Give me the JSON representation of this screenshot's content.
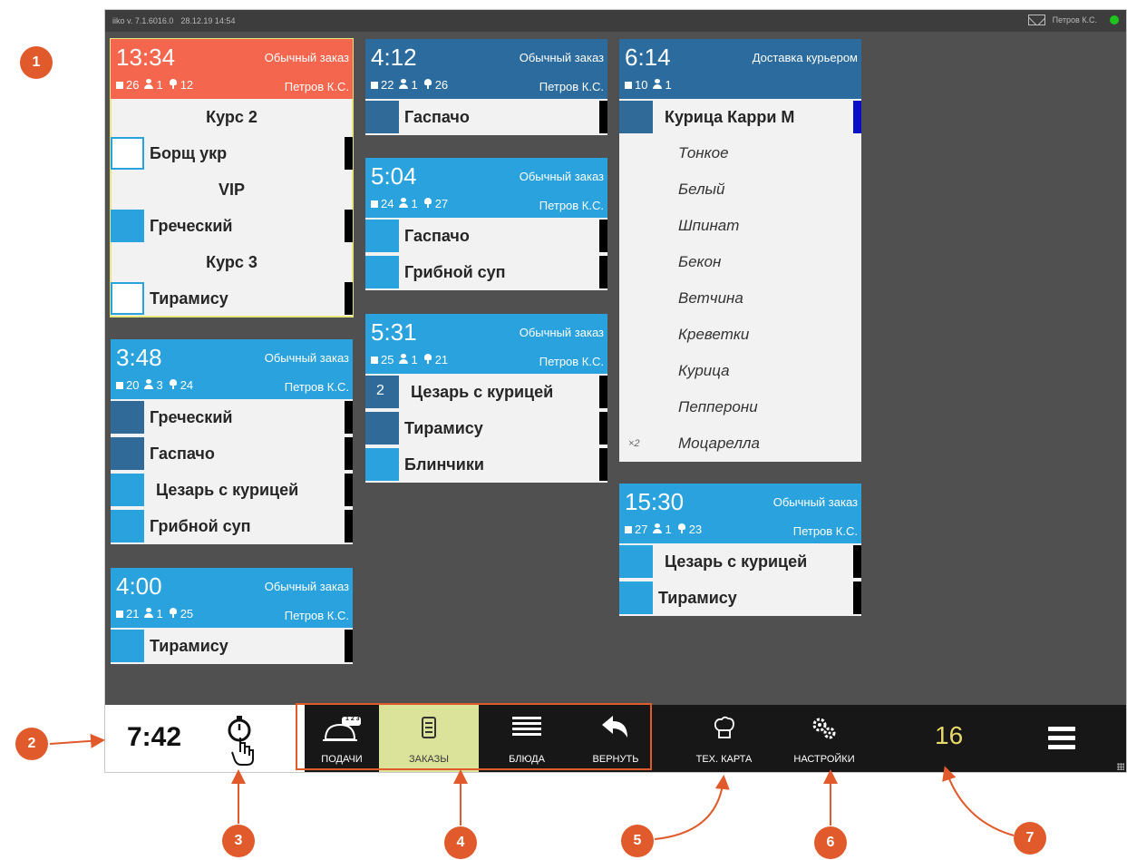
{
  "titlebar": {
    "version": "iiko  v. 7.1.6016.0",
    "datetime": "28.12.19  14:54",
    "user": "Петров К.С."
  },
  "colors": {
    "red_header": "#f4664e",
    "blue_header": "#29a2de",
    "dark_header": "#2b6b9d",
    "active_tab": "#dbe39a",
    "count": "#e6d96a",
    "callout": "#e05a2b"
  },
  "orders": [
    {
      "time": "13:34",
      "type": "Обычный заказ",
      "table": "26",
      "guests": "1",
      "order_no": "12",
      "waiter": "Петров К.С.",
      "items": [
        {
          "kind": "course",
          "name": "Курс 2"
        },
        {
          "kind": "dish",
          "name": "Борщ укр"
        },
        {
          "kind": "course",
          "name": "VIP"
        },
        {
          "kind": "dish",
          "name": "Греческий"
        },
        {
          "kind": "course",
          "name": "Курс 3"
        },
        {
          "kind": "dish",
          "name": "Тирамису"
        }
      ]
    },
    {
      "time": "3:48",
      "type": "Обычный заказ",
      "table": "20",
      "guests": "3",
      "order_no": "24",
      "waiter": "Петров К.С.",
      "items": [
        {
          "name": "Греческий"
        },
        {
          "name": "Гаспачо"
        },
        {
          "name": "Цезарь с курицей"
        },
        {
          "name": "Грибной суп"
        }
      ]
    },
    {
      "time": "4:00",
      "type": "Обычный заказ",
      "table": "21",
      "guests": "1",
      "order_no": "25",
      "waiter": "Петров К.С.",
      "items": [
        {
          "name": "Тирамису"
        }
      ]
    },
    {
      "time": "4:12",
      "type": "Обычный заказ",
      "table": "22",
      "guests": "1",
      "order_no": "26",
      "waiter": "Петров К.С.",
      "items": [
        {
          "name": "Гаспачо"
        }
      ]
    },
    {
      "time": "5:04",
      "type": "Обычный заказ",
      "table": "24",
      "guests": "1",
      "order_no": "27",
      "waiter": "Петров К.С.",
      "items": [
        {
          "name": "Гаспачо"
        },
        {
          "name": "Грибной суп"
        }
      ]
    },
    {
      "time": "5:31",
      "type": "Обычный заказ",
      "table": "25",
      "guests": "1",
      "order_no": "21",
      "waiter": "Петров К.С.",
      "items": [
        {
          "name": "Цезарь с курицей",
          "qty": "2"
        },
        {
          "name": "Тирамису"
        },
        {
          "name": "Блинчики"
        }
      ]
    },
    {
      "time": "6:14",
      "type": "Доставка курьером",
      "table": "10",
      "guests": "1",
      "items": [
        {
          "name": "Курица Карри М"
        }
      ],
      "modifiers": [
        {
          "name": "Тонкое"
        },
        {
          "name": "Белый"
        },
        {
          "name": "Шпинат"
        },
        {
          "name": "Бекон"
        },
        {
          "name": "Ветчина"
        },
        {
          "name": "Креветки"
        },
        {
          "name": "Курица"
        },
        {
          "name": "Пепперони"
        },
        {
          "name": "Моцарелла",
          "qty": "×2"
        }
      ]
    },
    {
      "time": "15:30",
      "type": "Обычный заказ",
      "table": "27",
      "guests": "1",
      "order_no": "23",
      "waiter": "Петров К.С.",
      "items": [
        {
          "name": "Цезарь с курицей"
        },
        {
          "name": "Тирамису"
        }
      ]
    }
  ],
  "toolbar": {
    "clock": "7:42",
    "tabs": {
      "courses": "ПОДАЧИ",
      "orders": "ЗАКАЗЫ",
      "dishes": "БЛЮДА",
      "back": "ВЕРНУТЬ"
    },
    "tech_card": "ТЕХ. КАРТА",
    "settings": "НАСТРОЙКИ",
    "count": "16",
    "courses_badge": "1 2 3"
  },
  "callouts": [
    "1",
    "2",
    "3",
    "4",
    "5",
    "6",
    "7"
  ]
}
